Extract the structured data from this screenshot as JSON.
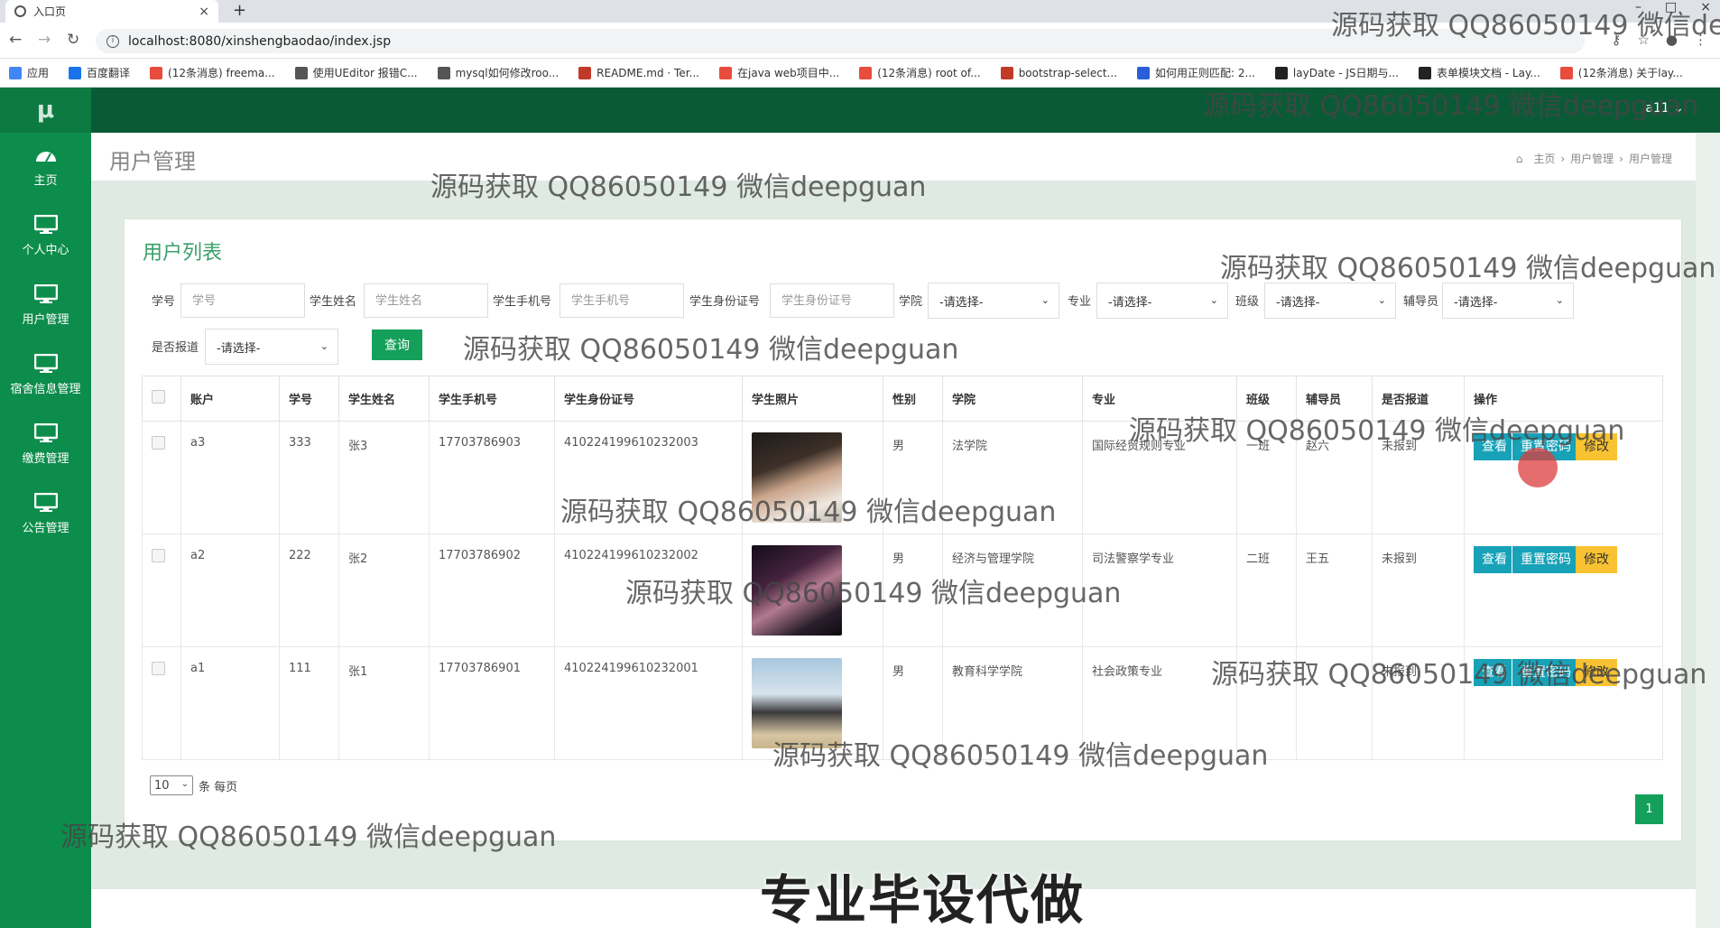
{
  "browser": {
    "tab_title": "入口页",
    "url": "localhost:8080/xinshengbaodao/index.jsp",
    "bookmarks": [
      "应用",
      "百度翻译",
      "(12条消息) freema...",
      "使用UEditor 报错C...",
      "mysql如何修改roo...",
      "README.md · Ter...",
      "在java web项目中...",
      "(12条消息) root of...",
      "bootstrap-select...",
      "如何用正则匹配: 2...",
      "layDate - JS日期与...",
      "表单模块文档 - Lay...",
      "(12条消息) 关于lay..."
    ]
  },
  "app": {
    "logo": "μ",
    "user": "a11 ⌄",
    "sidebar": [
      {
        "label": "主页",
        "icon": "dashboard-icon"
      },
      {
        "label": "个人中心",
        "icon": "monitor-icon"
      },
      {
        "label": "用户管理",
        "icon": "monitor-icon"
      },
      {
        "label": "宿舍信息管理",
        "icon": "monitor-icon"
      },
      {
        "label": "缴费管理",
        "icon": "monitor-icon"
      },
      {
        "label": "公告管理",
        "icon": "monitor-icon"
      }
    ]
  },
  "page": {
    "title": "用户管理",
    "breadcrumb": [
      "主页",
      "用户管理",
      "用户管理"
    ],
    "panel_title": "用户列表"
  },
  "filters": {
    "student_no": {
      "label": "学号",
      "placeholder": "学号"
    },
    "student_name": {
      "label": "学生姓名",
      "placeholder": "学生姓名"
    },
    "phone": {
      "label": "学生手机号",
      "placeholder": "学生手机号"
    },
    "id_card": {
      "label": "学生身份证号",
      "placeholder": "学生身份证号"
    },
    "college": {
      "label": "学院",
      "value": "-请选择-"
    },
    "major": {
      "label": "专业",
      "value": "-请选择-"
    },
    "class": {
      "label": "班级",
      "value": "-请选择-"
    },
    "counselor": {
      "label": "辅导员",
      "value": "-请选择-"
    },
    "reported": {
      "label": "是否报道",
      "value": "-请选择-"
    },
    "query_button": "查询"
  },
  "table": {
    "headers": [
      "账户",
      "学号",
      "学生姓名",
      "学生手机号",
      "学生身份证号",
      "学生照片",
      "性别",
      "学院",
      "专业",
      "班级",
      "辅导员",
      "是否报道",
      "操作"
    ],
    "rows": [
      {
        "account": "a3",
        "no": "333",
        "name": "张3",
        "phone": "17703786903",
        "id_card": "410224199610232003",
        "gender": "男",
        "college": "法学院",
        "major": "国际经贸规则专业",
        "class": "一班",
        "counselor": "赵六",
        "reported": "未报到"
      },
      {
        "account": "a2",
        "no": "222",
        "name": "张2",
        "phone": "17703786902",
        "id_card": "410224199610232002",
        "gender": "男",
        "college": "经济与管理学院",
        "major": "司法警察学专业",
        "class": "二班",
        "counselor": "王五",
        "reported": "未报到"
      },
      {
        "account": "a1",
        "no": "111",
        "name": "张1",
        "phone": "17703786901",
        "id_card": "410224199610232001",
        "gender": "男",
        "college": "教育科学学院",
        "major": "社会政策专业",
        "class": "",
        "counselor": "",
        "reported": "未报到"
      }
    ],
    "actions": {
      "view": "查看",
      "reset": "重置密码",
      "edit": "修改"
    }
  },
  "pagination": {
    "page_size": "10",
    "per_page_label": "条 每页",
    "current_page": "1"
  },
  "overlay": {
    "watermark": "源码获取 QQ86050149 微信deepguan",
    "promo": "专业毕设代做"
  }
}
